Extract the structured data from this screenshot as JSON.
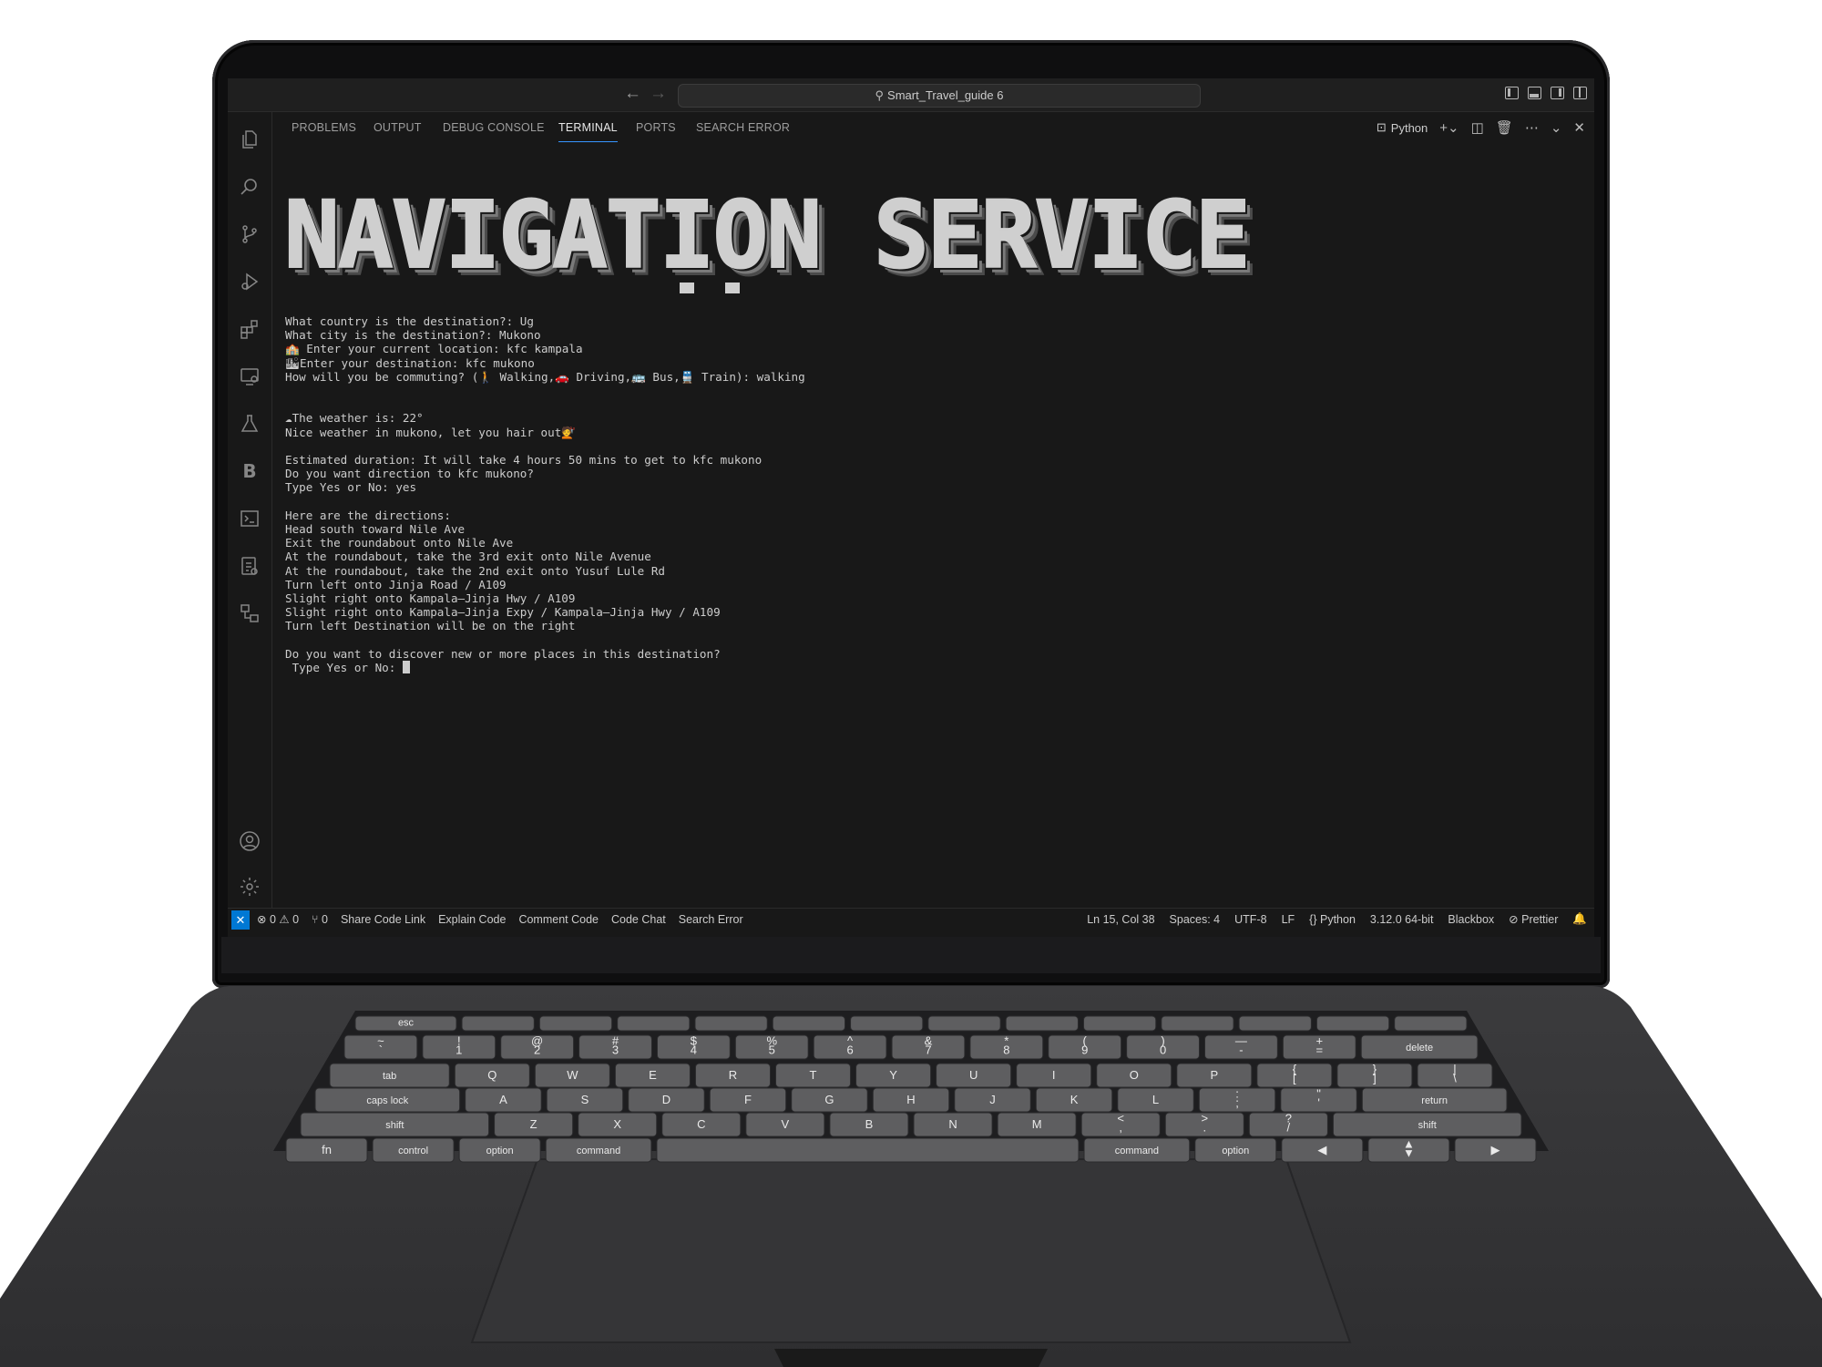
{
  "window": {
    "search_title": "Smart_Travel_guide 6"
  },
  "activity_bar": {
    "items": [
      "explorer-icon",
      "search-icon",
      "source-control-icon",
      "run-debug-icon",
      "extensions-icon",
      "remote-explorer-icon",
      "testing-icon",
      "blackbox-icon",
      "terminal-icon",
      "docker-icon",
      "diagram-icon",
      "account-icon",
      "settings-icon"
    ],
    "blackbox_letter": "B"
  },
  "panel": {
    "tabs": [
      "PROBLEMS",
      "OUTPUT",
      "DEBUG CONSOLE",
      "TERMINAL",
      "PORTS",
      "SEARCH ERROR"
    ],
    "active_tab": "TERMINAL",
    "shell_label": "Python"
  },
  "terminal": {
    "banner": "NAVIGATION SERVICE",
    "lines": [
      "What country is the destination?: Ug",
      "What city is the destination?: Mukono",
      "🏫 Enter your current location: kfc kampala",
      "🏙Enter your destination: kfc mukono",
      "How will you be commuting? (🚶 Walking,🚗 Driving,🚌 Bus,🚆 Train): walking",
      "",
      "",
      "☁The weather is: 22°",
      "Nice weather in mukono, let you hair out💇",
      "",
      "Estimated duration: It will take 4 hours 50 mins to get to kfc mukono",
      "Do you want direction to kfc mukono?",
      "Type Yes or No: yes",
      "",
      "Here are the directions:",
      "Head south toward Nile Ave",
      "Exit the roundabout onto Nile Ave",
      "At the roundabout, take the 3rd exit onto Nile Avenue",
      "At the roundabout, take the 2nd exit onto Yusuf Lule Rd",
      "Turn left onto Jinja Road / A109",
      "Slight right onto Kampala–Jinja Hwy / A109",
      "Slight right onto Kampala–Jinja Expy / Kampala–Jinja Hwy / A109",
      "Turn left Destination will be on the right",
      "",
      "Do you want to discover new or more places in this destination?"
    ],
    "prompt": " Type Yes or No: "
  },
  "status_bar": {
    "remote": "✕",
    "errors": "0",
    "warnings": "0",
    "ports": "0",
    "actions": [
      "Share Code Link",
      "Explain Code",
      "Comment Code",
      "Code Chat",
      "Search Error"
    ],
    "position": "Ln 15, Col 38",
    "spaces": "Spaces: 4",
    "encoding": "UTF-8",
    "eol": "LF",
    "language": "Python",
    "interpreter": "3.12.0 64-bit",
    "blackbox": "Blackbox",
    "prettier": "Prettier"
  },
  "keyboard": {
    "row_fn": [
      "esc",
      "",
      "",
      "",
      "",
      "",
      "",
      "",
      "",
      "",
      "",
      "",
      "",
      ""
    ],
    "row_num": [
      "~\n`",
      "!\n1",
      "@\n2",
      "#\n3",
      "$\n4",
      "%\n5",
      "^\n6",
      "&\n7",
      "*\n8",
      "(\n9",
      ")\n0",
      "—\n-",
      "+\n=",
      "delete"
    ],
    "row_q": [
      "tab",
      "Q",
      "W",
      "E",
      "R",
      "T",
      "Y",
      "U",
      "I",
      "O",
      "P",
      "{\n[",
      "}\n]",
      "|\n\\"
    ],
    "row_a": [
      "caps lock",
      "A",
      "S",
      "D",
      "F",
      "G",
      "H",
      "J",
      "K",
      "L",
      ":\n;",
      "\"\n'",
      "return"
    ],
    "row_z": [
      "shift",
      "Z",
      "X",
      "C",
      "V",
      "B",
      "N",
      "M",
      "<\n,",
      ">\n.",
      "?\n/",
      "shift"
    ],
    "row_bottom": [
      "fn",
      "control",
      "option",
      "command",
      "",
      "command",
      "option",
      "◀",
      "▲\n▼",
      "▶"
    ]
  },
  "colors": {
    "accent": "#3794ff",
    "remote_bg": "#0078d4",
    "editor_bg": "#181818"
  }
}
